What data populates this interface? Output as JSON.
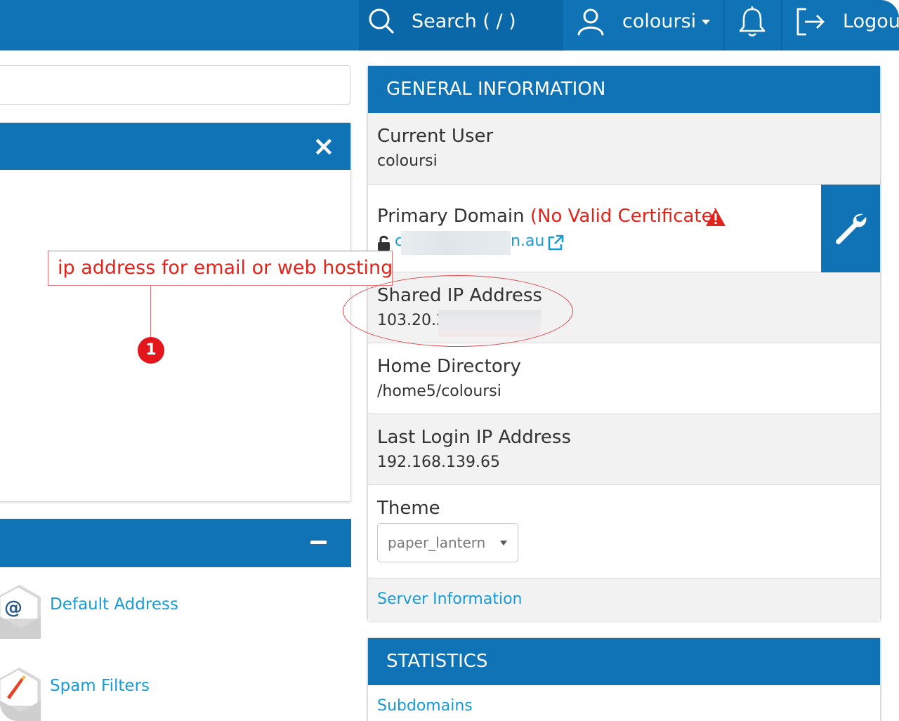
{
  "topbar": {
    "search_placeholder": "Search ( / )",
    "username": "coloursi",
    "logout_label": "Logout",
    "icons": [
      "search-icon",
      "user-icon",
      "caret-down-icon",
      "bell-icon",
      "logout-icon"
    ]
  },
  "left": {
    "panel1_close": "×",
    "panel2_collapse": "−",
    "tools": [
      {
        "label": "Default Address",
        "icon": "at-envelope-icon"
      },
      {
        "label": "Spam Filters",
        "icon": "spam-filter-icon"
      }
    ]
  },
  "annotation": {
    "text": "ip address for email or web hosting",
    "badge": "1"
  },
  "general_info": {
    "header": "GENERAL INFORMATION",
    "current_user_label": "Current User",
    "current_user_value": "coloursi",
    "primary_domain_label": "Primary Domain",
    "certificate_warning": "(No Valid Certificate)",
    "primary_domain_value_start": "c",
    "primary_domain_value_end": "n.au",
    "shared_ip_label": "Shared IP Address",
    "shared_ip_value": "103.20.2",
    "home_dir_label": "Home Directory",
    "home_dir_value": "/home5/coloursi",
    "last_login_label": "Last Login IP Address",
    "last_login_value": "192.168.139.65",
    "theme_label": "Theme",
    "theme_value": "paper_lantern",
    "server_info_link": "Server Information"
  },
  "statistics": {
    "header": "STATISTICS",
    "first_item": "Subdomains"
  },
  "colors": {
    "brand_blue": "#0f73b6",
    "link_blue": "#179bd7",
    "warning_red": "#e2231a"
  }
}
